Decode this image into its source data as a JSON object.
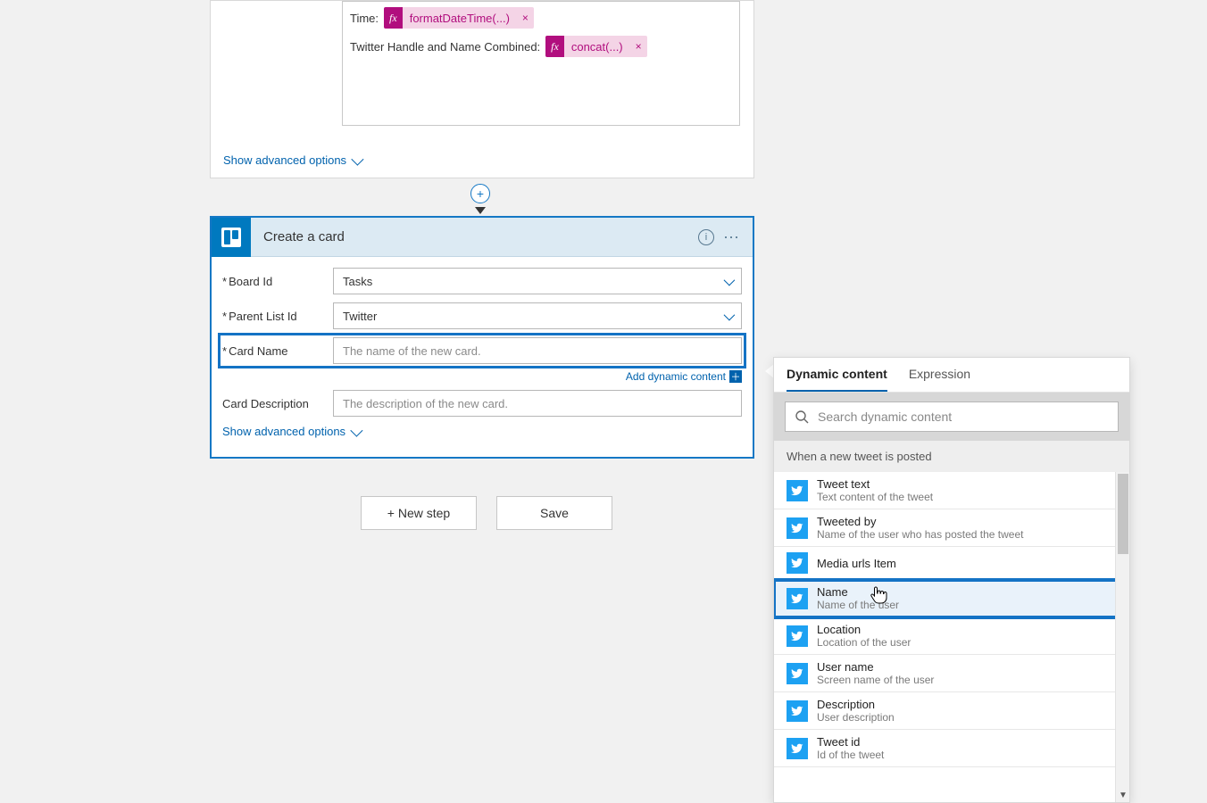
{
  "compose": {
    "time_label": "Time:",
    "time_fx": "formatDateTime(...)",
    "combined_label": "Twitter Handle and Name Combined:",
    "combined_fx": "concat(...)",
    "show_advanced": "Show advanced options"
  },
  "action": {
    "title": "Create a card",
    "board_label": "Board Id",
    "board_value": "Tasks",
    "parent_label": "Parent List Id",
    "parent_value": "Twitter",
    "cardname_label": "Card Name",
    "cardname_placeholder": "The name of the new card.",
    "add_dynamic": "Add dynamic content",
    "carddesc_label": "Card Description",
    "carddesc_placeholder": "The description of the new card.",
    "show_advanced": "Show advanced options"
  },
  "buttons": {
    "new_step": "+ New step",
    "save": "Save"
  },
  "dyn": {
    "tab_dynamic": "Dynamic content",
    "tab_expression": "Expression",
    "search_placeholder": "Search dynamic content",
    "section_title": "When a new tweet is posted",
    "items": [
      {
        "name": "Tweet text",
        "desc": "Text content of the tweet"
      },
      {
        "name": "Tweeted by",
        "desc": "Name of the user who has posted the tweet"
      },
      {
        "name": "Media urls Item",
        "desc": ""
      },
      {
        "name": "Name",
        "desc": "Name of the user"
      },
      {
        "name": "Location",
        "desc": "Location of the user"
      },
      {
        "name": "User name",
        "desc": "Screen name of the user"
      },
      {
        "name": "Description",
        "desc": "User description"
      },
      {
        "name": "Tweet id",
        "desc": "Id of the tweet"
      }
    ]
  }
}
